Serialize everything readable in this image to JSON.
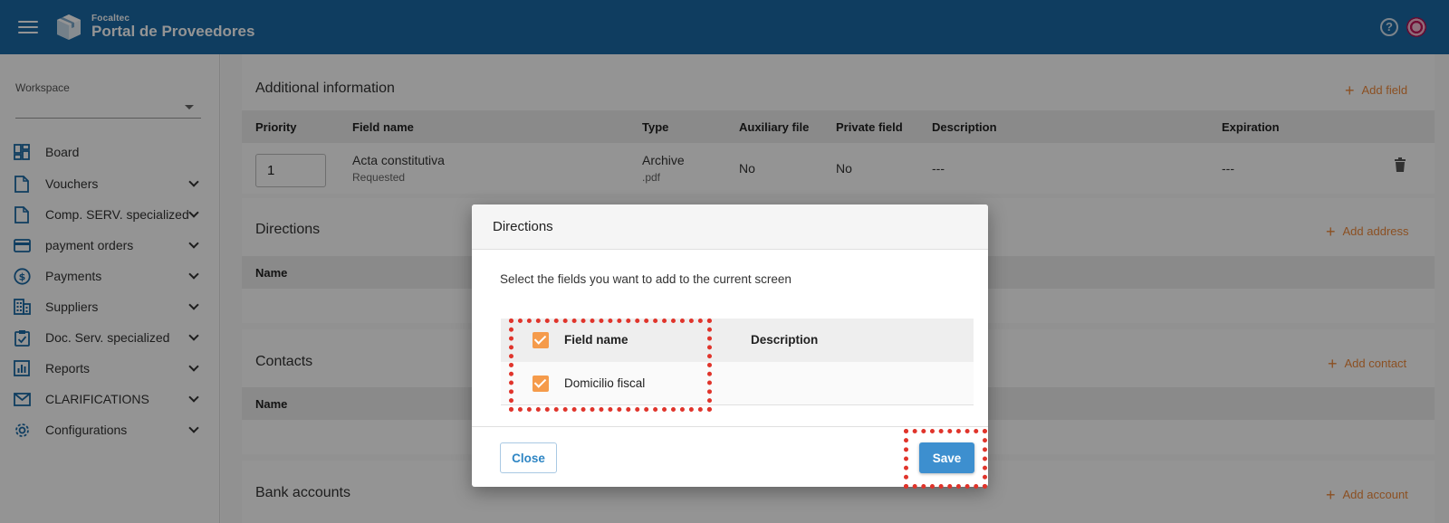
{
  "header": {
    "brand_small": "Focaltec",
    "brand_big": "Portal de Proveedores",
    "help_icon": "help-icon",
    "avatar": "avatar"
  },
  "sidebar": {
    "workspace_label": "Workspace",
    "workspace_value": "",
    "items": [
      {
        "label": "Board",
        "icon": "dashboard-icon",
        "expandable": false
      },
      {
        "label": "Vouchers",
        "icon": "document-icon",
        "expandable": true
      },
      {
        "label": "Comp. SERV. specialized",
        "icon": "document-icon",
        "expandable": true
      },
      {
        "label": "payment orders",
        "icon": "credit-card-icon",
        "expandable": true
      },
      {
        "label": "Payments",
        "icon": "dollar-icon",
        "expandable": true
      },
      {
        "label": "Suppliers",
        "icon": "building-icon",
        "expandable": true
      },
      {
        "label": "Doc. Serv. specialized",
        "icon": "clipboard-check-icon",
        "expandable": true
      },
      {
        "label": "Reports",
        "icon": "chart-icon",
        "expandable": true
      },
      {
        "label": "CLARIFICATIONS",
        "icon": "mail-icon",
        "expandable": true
      },
      {
        "label": "Configurations",
        "icon": "gear-icon",
        "expandable": true
      }
    ]
  },
  "main": {
    "additional": {
      "title": "Additional information",
      "add_label": "Add field",
      "columns": [
        "Priority",
        "Field name",
        "Type",
        "Auxiliary file",
        "Private field",
        "Description",
        "Expiration"
      ],
      "row": {
        "priority": "1",
        "field_name": "Acta constitutiva",
        "field_sub": "Requested",
        "type": "Archive",
        "type_sub": ".pdf",
        "auxiliary": "No",
        "private": "No",
        "description": "---",
        "expiration": "---"
      }
    },
    "directions": {
      "title": "Directions",
      "add_label": "Add address",
      "column": "Name"
    },
    "contacts": {
      "title": "Contacts",
      "add_label": "Add contact",
      "column": "Name"
    },
    "bank": {
      "title": "Bank accounts",
      "add_label": "Add account"
    }
  },
  "modal": {
    "title": "Directions",
    "description": "Select the fields you want to add to the current screen",
    "col_field": "Field name",
    "col_description": "Description",
    "rows": [
      {
        "field": "Domicilio fiscal",
        "description": "",
        "checked": true
      }
    ],
    "close_label": "Close",
    "save_label": "Save"
  },
  "colors": {
    "header": "#1a6aa6",
    "accent": "#f08a3c",
    "checkbox": "#f59b4b",
    "primary_button": "#3d8fcf",
    "highlight": "#e0342b"
  }
}
